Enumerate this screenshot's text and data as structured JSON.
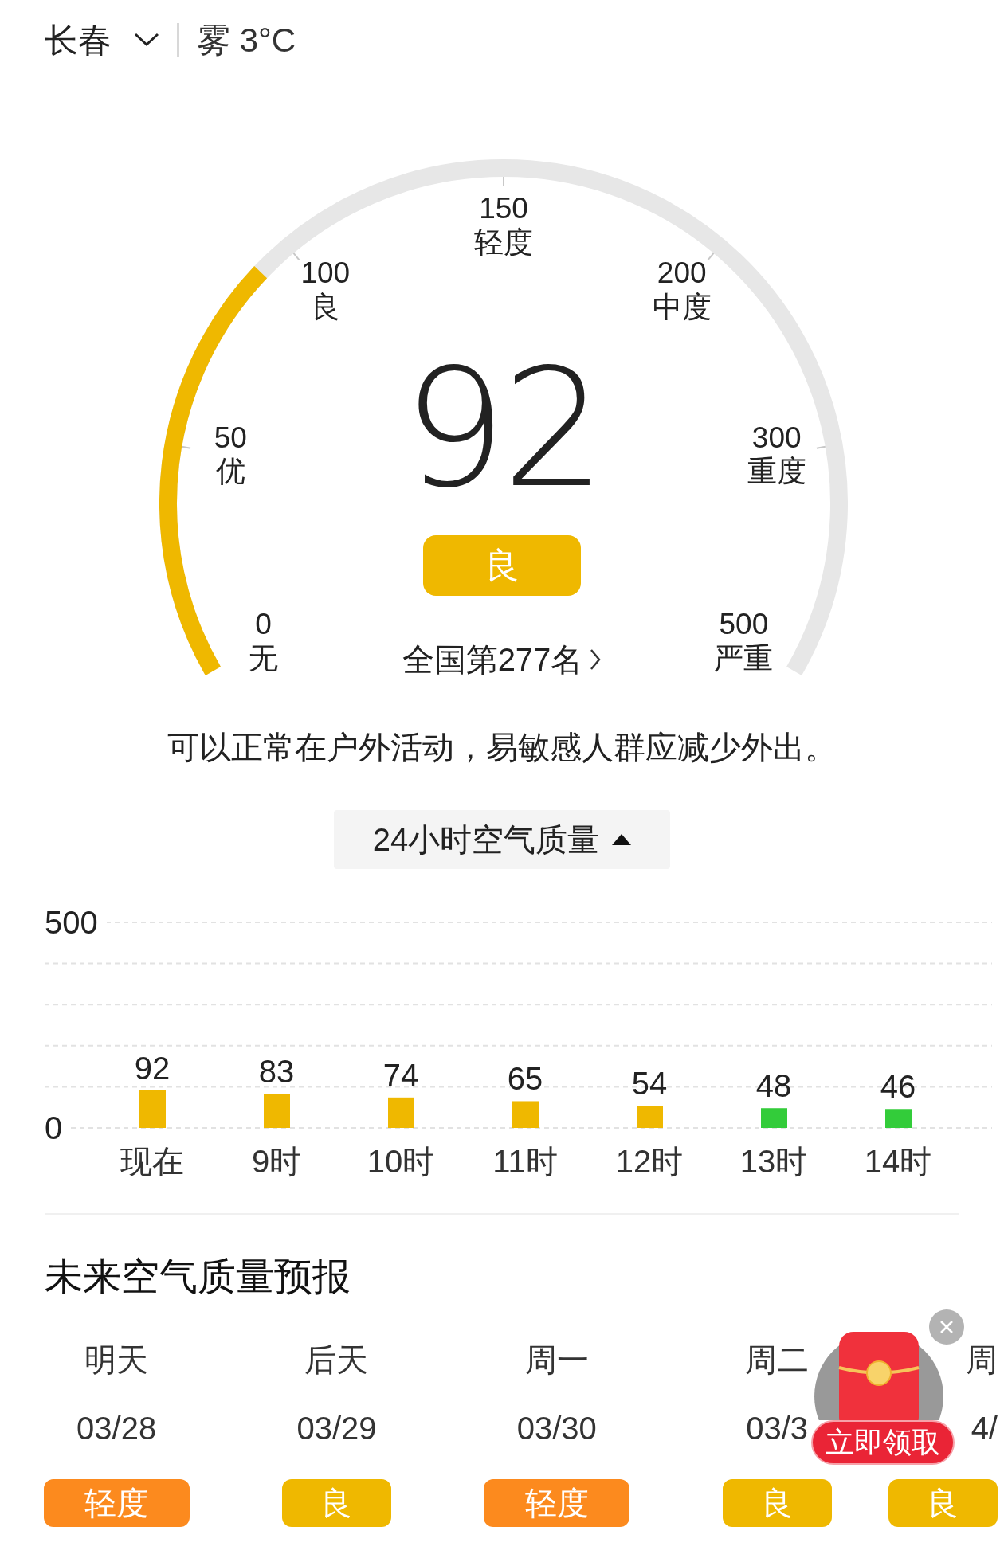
{
  "header": {
    "city": "长春",
    "weather": "雾 3°C"
  },
  "gauge": {
    "value": "92",
    "grade": "良",
    "rank": "全国第277名",
    "ticks": [
      {
        "value": "0",
        "label": "无"
      },
      {
        "value": "50",
        "label": "优"
      },
      {
        "value": "100",
        "label": "良"
      },
      {
        "value": "150",
        "label": "轻度"
      },
      {
        "value": "200",
        "label": "中度"
      },
      {
        "value": "300",
        "label": "重度"
      },
      {
        "value": "500",
        "label": "严重"
      }
    ]
  },
  "advice": "可以正常在户外活动，易敏感人群应减少外出。",
  "hourly": {
    "toggle": {
      "label": "24小时空气质量",
      "expanded": true
    },
    "chart_data": {
      "type": "bar",
      "categories": [
        "现在",
        "9时",
        "10时",
        "11时",
        "12时",
        "13时",
        "14时"
      ],
      "data_labels": true,
      "ylim": [
        0,
        500
      ],
      "yticks": [
        0,
        500
      ],
      "values": [
        92,
        83,
        74,
        65,
        54,
        48,
        46
      ]
    }
  },
  "forecast": {
    "title": "未来空气质量预报",
    "days": [
      {
        "day": "明天",
        "date": "03/28",
        "grade": "轻度",
        "color": "#fc8a1e"
      },
      {
        "day": "后天",
        "date": "03/29",
        "grade": "良",
        "color": "#efb800"
      },
      {
        "day": "周一",
        "date": "03/30",
        "grade": "轻度",
        "color": "#fc8a1e"
      },
      {
        "day": "周二",
        "date": "03/3",
        "grade": "良",
        "color": "#efb800"
      },
      {
        "day": "周",
        "date": "4/",
        "grade": "良",
        "color": "#efb800"
      }
    ]
  },
  "promo": {
    "label": "立即领取"
  }
}
